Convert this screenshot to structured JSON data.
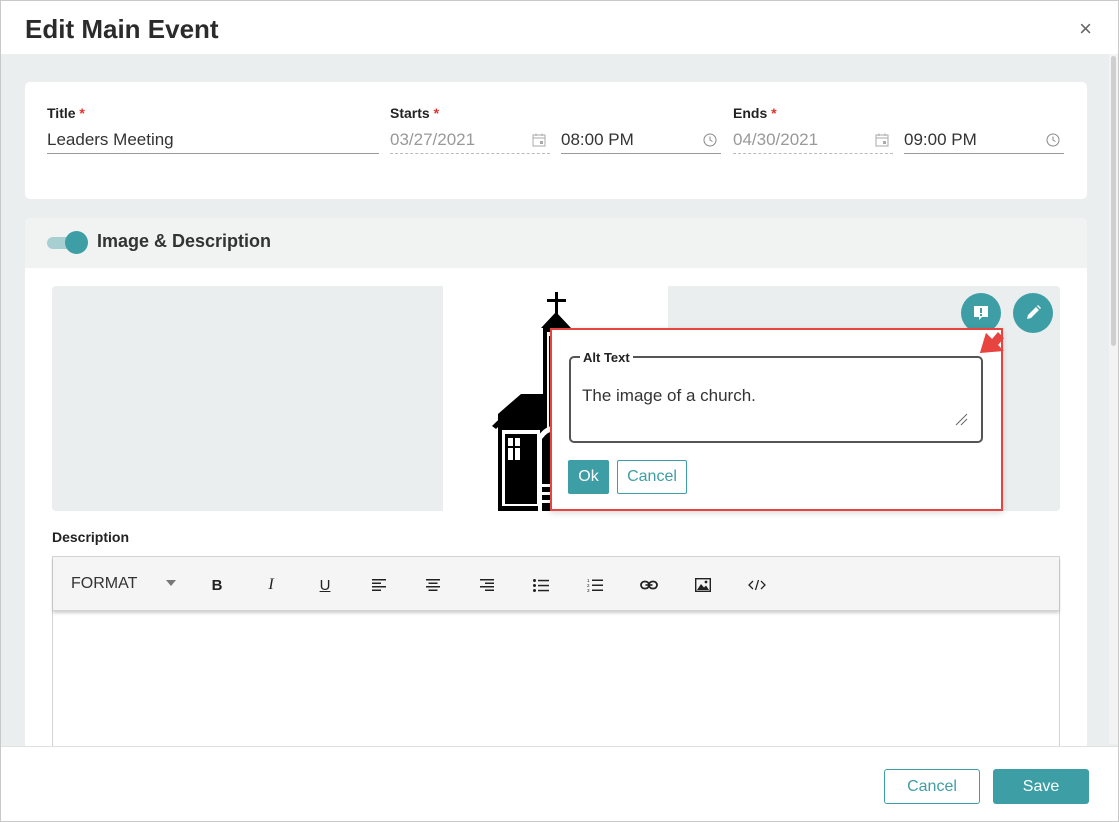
{
  "dialog": {
    "title": "Edit Main Event",
    "close_symbol": "×"
  },
  "dates": {
    "title_label": "Title",
    "title_value": "Leaders Meeting",
    "starts_label": "Starts",
    "starts_date": "03/27/2021",
    "starts_time": "08:00 PM",
    "ends_label": "Ends",
    "ends_date": "04/30/2021",
    "ends_time": "09:00 PM",
    "required_marker": "*"
  },
  "image_section": {
    "title": "Image & Description",
    "toggle_on": true,
    "image_icon": "church-illustration",
    "alt_text_button_icon": "alt-text-icon",
    "edit_button_icon": "pencil-icon"
  },
  "alt_text_popup": {
    "label": "Alt Text",
    "value": "The image of a church.",
    "ok_label": "Ok",
    "cancel_label": "Cancel"
  },
  "description": {
    "label": "Description",
    "toolbar": {
      "format_label": "FORMAT",
      "bold": "B",
      "italic": "I",
      "underline": "U"
    }
  },
  "footer": {
    "cancel_label": "Cancel",
    "save_label": "Save"
  },
  "colors": {
    "accent": "#3d9ea5",
    "highlight": "#e8443f",
    "required": "#e0342d"
  }
}
